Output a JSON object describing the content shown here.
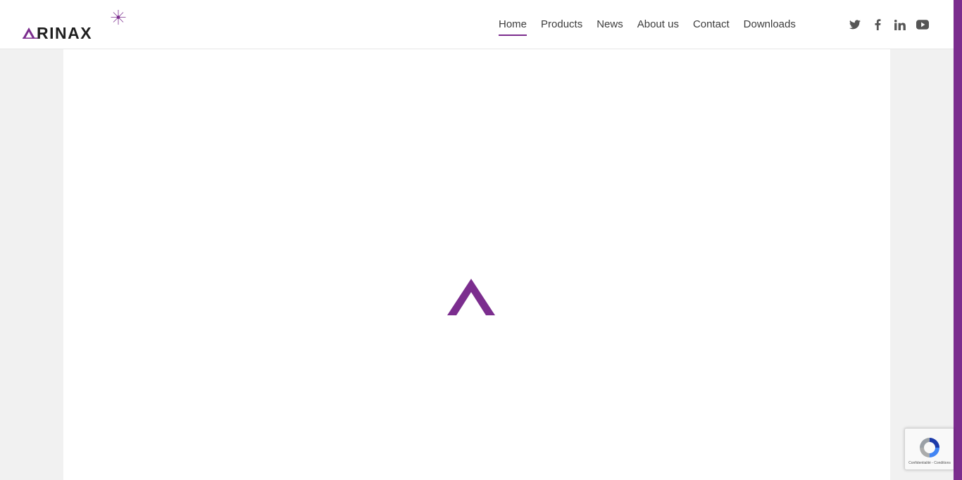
{
  "brand": {
    "name": "ARINAX",
    "logo_rest_text": "RINAX",
    "primary_color": "#7b2d8e",
    "text_color": "#1f1f1f",
    "side_accent_color": "#7b2d8e"
  },
  "nav": {
    "active_color": "#7b2d8e",
    "items": [
      {
        "label": "Home",
        "active": true
      },
      {
        "label": "Products",
        "active": false
      },
      {
        "label": "News",
        "active": false
      },
      {
        "label": "About us",
        "active": false
      },
      {
        "label": "Contact",
        "active": false
      },
      {
        "label": "Downloads",
        "active": false
      }
    ]
  },
  "social": {
    "icon_color": "#555555",
    "icons": [
      "twitter-icon",
      "facebook-icon",
      "linkedin-icon",
      "youtube-icon"
    ]
  },
  "loader": {
    "icon": "arinax-a-mark-icon",
    "color": "#7b2d8e"
  },
  "recaptcha": {
    "terms_text": "Confidentialité - Conditions",
    "icon": "recaptcha-icon"
  }
}
